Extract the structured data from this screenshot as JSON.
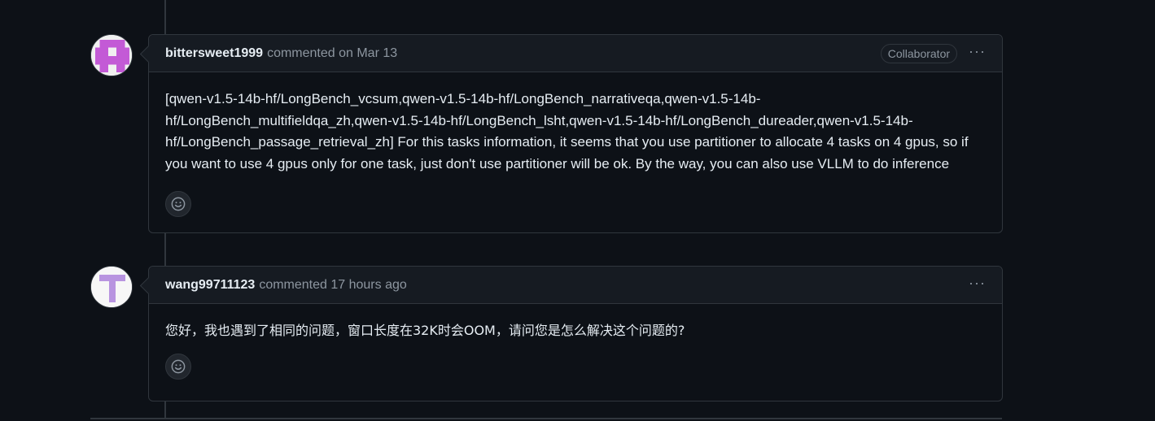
{
  "comments": [
    {
      "author": "bittersweet1999",
      "meta": "commented on Mar 13",
      "role_badge": "Collaborator",
      "more_label": "···",
      "body": "[qwen-v1.5-14b-hf/LongBench_vcsum,qwen-v1.5-14b-hf/LongBench_narrativeqa,qwen-v1.5-14b-hf/LongBench_multifieldqa_zh,qwen-v1.5-14b-hf/LongBench_lsht,qwen-v1.5-14b-hf/LongBench_dureader,qwen-v1.5-14b-hf/LongBench_passage_retrieval_zh] For this tasks information, it seems that you use partitioner to allocate 4 tasks on 4 gpus, so if you want to use 4 gpus only for one task, just don't use partitioner will be ok. By the way, you can also use VLLM to do inference",
      "avatar": {
        "type": "identicon",
        "color": "#c35ad6",
        "icon": "identicon-avatar"
      }
    },
    {
      "author": "wang99711123",
      "meta": "commented 17 hours ago",
      "more_label": "···",
      "body": "您好，我也遇到了相同的问题，窗口长度在32K时会OOM，请问您是怎么解决这个问题的?",
      "avatar": {
        "type": "letter",
        "letter": "T",
        "color": "#b894e0",
        "icon": "letter-avatar"
      }
    }
  ],
  "colors": {
    "background": "#0d1117",
    "header_bg": "#161b22",
    "border": "#30363d",
    "muted_text": "#8d96a0",
    "text": "#e6edf3",
    "highlight_border": "#1f6feb"
  },
  "icons": {
    "reaction": "smiley-icon",
    "more": "kebab-horizontal-icon"
  }
}
